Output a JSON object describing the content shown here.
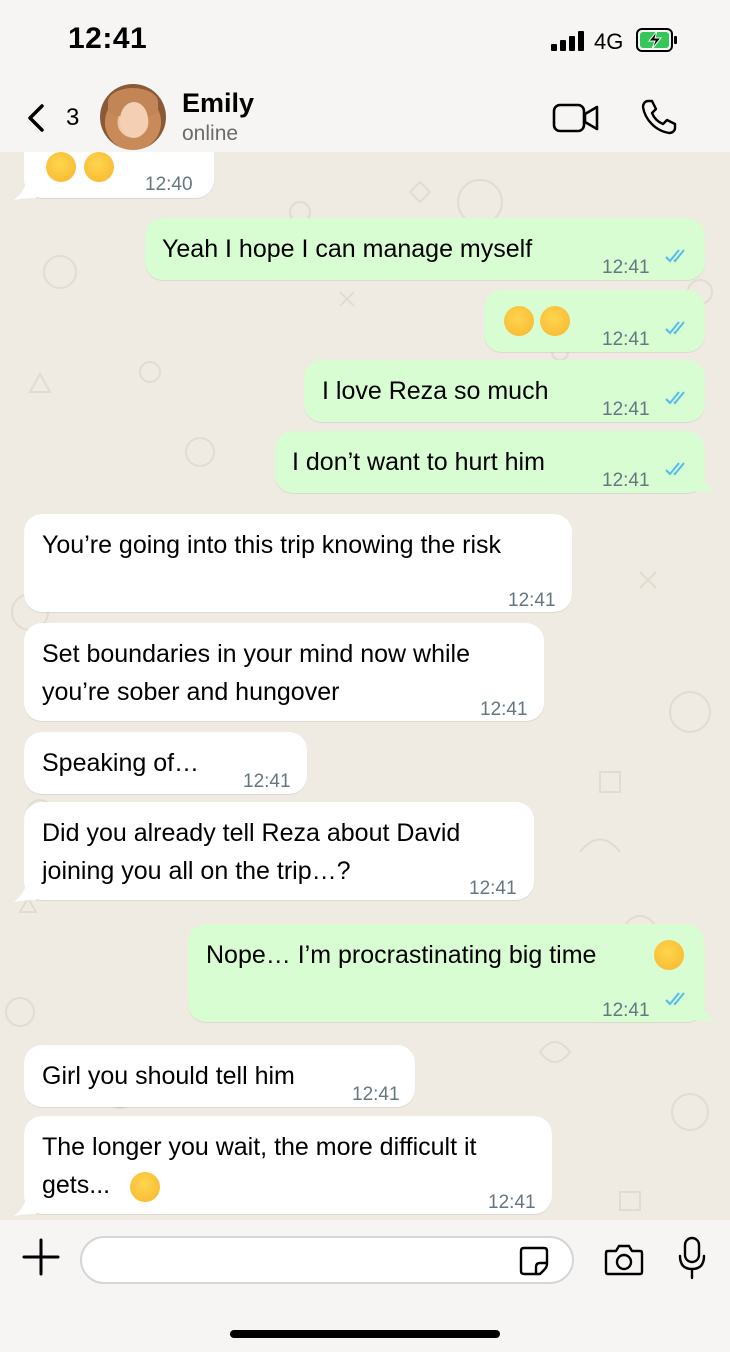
{
  "status_bar": {
    "time": "12:41",
    "network": "4G",
    "battery_state": "charging"
  },
  "header": {
    "back_count": "3",
    "contact_name": "Emily",
    "contact_status": "online",
    "icons": [
      "chevron-left-icon",
      "video-icon",
      "phone-icon"
    ]
  },
  "messages": [
    {
      "dir": "in",
      "text": "",
      "emojis": [
        "face-holding-back-tears",
        "face-holding-back-tears"
      ],
      "time": "12:40"
    },
    {
      "dir": "out",
      "text": "Yeah I hope I can manage myself",
      "time": "12:41",
      "read": true
    },
    {
      "dir": "out",
      "text": "",
      "emojis": [
        "face-with-tears-of-joy",
        "face-with-tears-of-joy"
      ],
      "time": "12:41",
      "read": true
    },
    {
      "dir": "out",
      "text": "I love Reza so much",
      "time": "12:41",
      "read": true
    },
    {
      "dir": "out",
      "text": "I don’t want to hurt him",
      "time": "12:41",
      "read": true
    },
    {
      "dir": "in",
      "text": "You’re going into this trip knowing the risk",
      "time": "12:41"
    },
    {
      "dir": "in",
      "lines": [
        "Set boundaries in your mind now while",
        "you’re sober and hungover"
      ],
      "time": "12:41"
    },
    {
      "dir": "in",
      "text": "Speaking of…",
      "time": "12:41"
    },
    {
      "dir": "in",
      "lines": [
        "Did you already tell Reza about David",
        "joining you all on the trip…?"
      ],
      "time": "12:41"
    },
    {
      "dir": "out",
      "text": "Nope… I’m procrastinating big time",
      "emojis": [
        "flushed-face"
      ],
      "time": "12:41",
      "read": true
    },
    {
      "dir": "in",
      "text": "Girl you should tell him",
      "time": "12:41"
    },
    {
      "dir": "in",
      "lines": [
        "The longer you wait, the more difficult it",
        "gets..."
      ],
      "emojis": [
        "grimacing-face"
      ],
      "time": "12:41"
    }
  ],
  "input": {
    "value": "",
    "placeholder": ""
  },
  "colors": {
    "outgoing_bubble": "#d9fdd3",
    "incoming_bubble": "#ffffff",
    "read_ticks": "#53bdeb",
    "timestamp": "#667781",
    "wallpaper": "#efeae2"
  }
}
